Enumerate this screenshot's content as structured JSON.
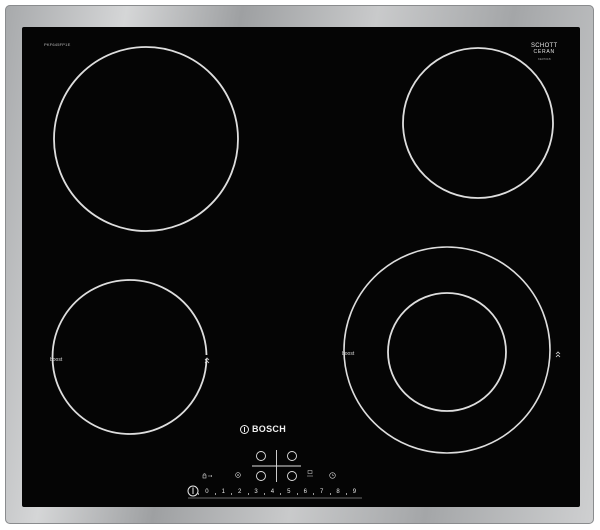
{
  "model_number": "PKF645FP1E",
  "brand": "BOSCH",
  "glass_brand": {
    "line1": "SCHOTT",
    "line2": "CERAN",
    "line3": "KE0701B"
  },
  "zones": [
    {
      "id": "rear-left",
      "boost_label": ""
    },
    {
      "id": "rear-right",
      "boost_label": ""
    },
    {
      "id": "front-left",
      "boost_label": "boost",
      "boost_icon": "double-chevron-icon"
    },
    {
      "id": "front-right-dual",
      "boost_label": "boost",
      "boost_icon": "double-chevron-icon"
    }
  ],
  "controls": {
    "power_icon": "power-icon",
    "lock_symbol": "🔒",
    "timer_symbol": "⊙",
    "eco_symbol": "⊞",
    "clock_symbol": "◷",
    "power_levels": [
      "0",
      "1",
      "2",
      "3",
      "4",
      "5",
      "6",
      "7",
      "8",
      "9"
    ],
    "power_glyph": "Ⅰ"
  },
  "colors": {
    "glass": "#050505",
    "frame": "#b5b7b9",
    "markings": "#e6e6e6"
  }
}
